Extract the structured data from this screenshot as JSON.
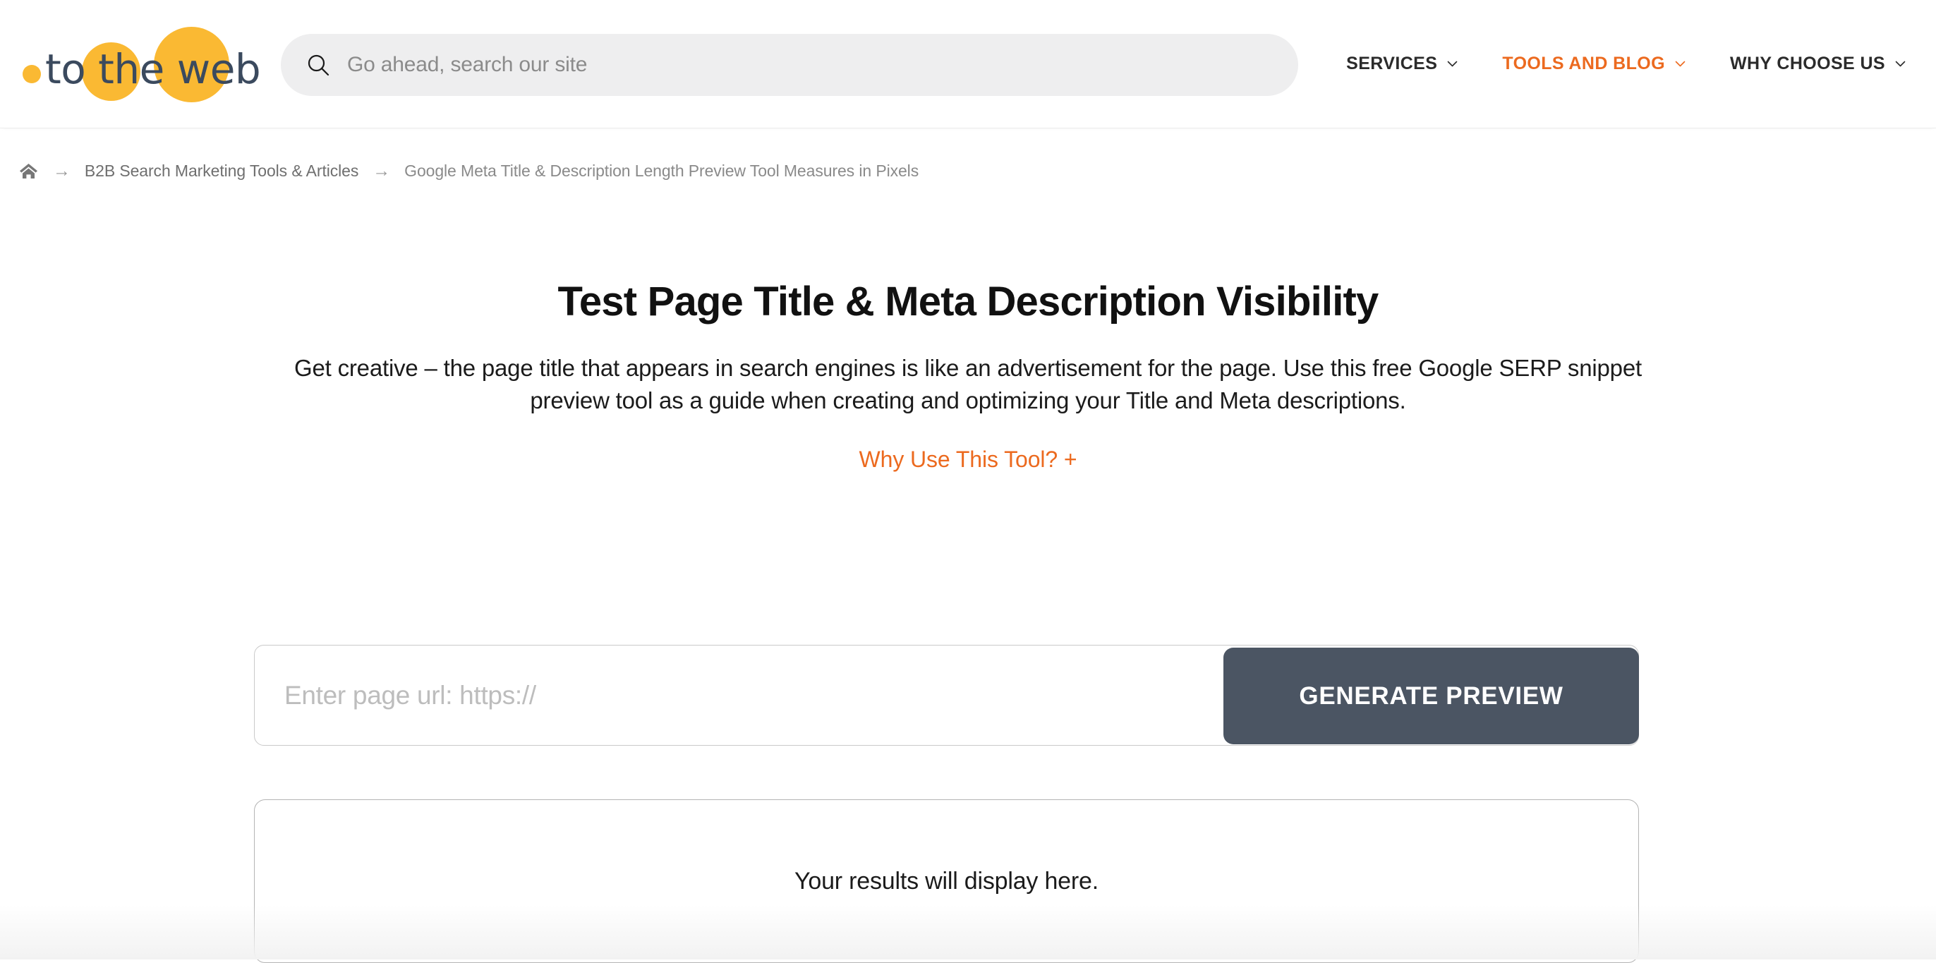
{
  "colors": {
    "logo_orange": "#fab933",
    "logo_navy": "#3b4a5e",
    "nav_accent_orange": "#ec6a1f",
    "button_bg": "#4b5563",
    "search_bg": "#eeeeef",
    "border_gray": "#c9c9c9"
  },
  "header": {
    "logo": {
      "text": "to the web",
      "dot_icon": "logo-dot-icon",
      "circle_the_icon": "logo-circle-icon",
      "circle_web_icon": "logo-circle-icon"
    },
    "search": {
      "icon": "search-icon",
      "placeholder": "Go ahead, search our site",
      "value": ""
    },
    "nav": [
      {
        "label": "SERVICES",
        "active": false,
        "caret_icon": "chevron-down-icon"
      },
      {
        "label": "TOOLS AND BLOG",
        "active": true,
        "caret_icon": "chevron-down-icon"
      },
      {
        "label": "WHY CHOOSE US",
        "active": false,
        "caret_icon": "chevron-down-icon"
      }
    ]
  },
  "breadcrumb": {
    "home_icon": "home-icon",
    "separator": "→",
    "items": [
      {
        "label": "B2B Search Marketing Tools & Articles",
        "current": false
      },
      {
        "label": "Google Meta Title & Description Length Preview Tool Measures in Pixels",
        "current": true
      }
    ]
  },
  "main": {
    "title": "Test Page Title & Meta Description Visibility",
    "intro": "Get creative – the page title that appears in search engines is like an advertisement for the page. Use this free Google SERP snippet preview tool as a guide when creating and optimizing your Title and Meta descriptions.",
    "why_use_link": "Why Use This Tool? +",
    "form": {
      "url_placeholder": "Enter page url: https://",
      "url_value": "",
      "submit_label": "GENERATE PREVIEW"
    },
    "results": {
      "placeholder": "Your results will display here."
    }
  }
}
